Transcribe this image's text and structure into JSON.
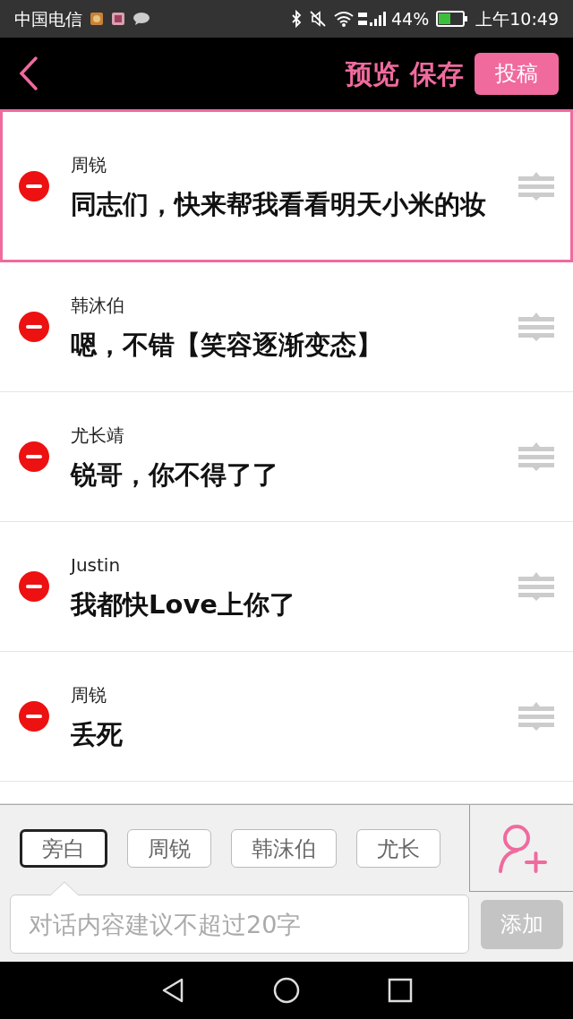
{
  "status_bar": {
    "carrier": "中国电信",
    "battery": "44%",
    "time": "上午10:49"
  },
  "header": {
    "actions": [
      "预览",
      "保存"
    ],
    "submit_button": "投稿"
  },
  "messages": [
    {
      "speaker": "周锐",
      "text": "同志们，快来帮我看看明天小米的妆",
      "selected": true
    },
    {
      "speaker": "韩沐伯",
      "text": "嗯，不错【笑容逐渐变态】",
      "selected": false
    },
    {
      "speaker": "尤长靖",
      "text": "锐哥，你不得了了",
      "selected": false
    },
    {
      "speaker": "Justin",
      "text": "我都快Love上你了",
      "selected": false
    },
    {
      "speaker": "周锐",
      "text": "丢死",
      "selected": false
    }
  ],
  "speaker_chips": [
    {
      "label": "旁白",
      "selected": true
    },
    {
      "label": "周锐",
      "selected": false
    },
    {
      "label": "韩沫伯",
      "selected": false
    },
    {
      "label": "尤长",
      "selected": false
    }
  ],
  "input": {
    "placeholder": "对话内容建议不超过20字"
  },
  "add_button": "添加"
}
